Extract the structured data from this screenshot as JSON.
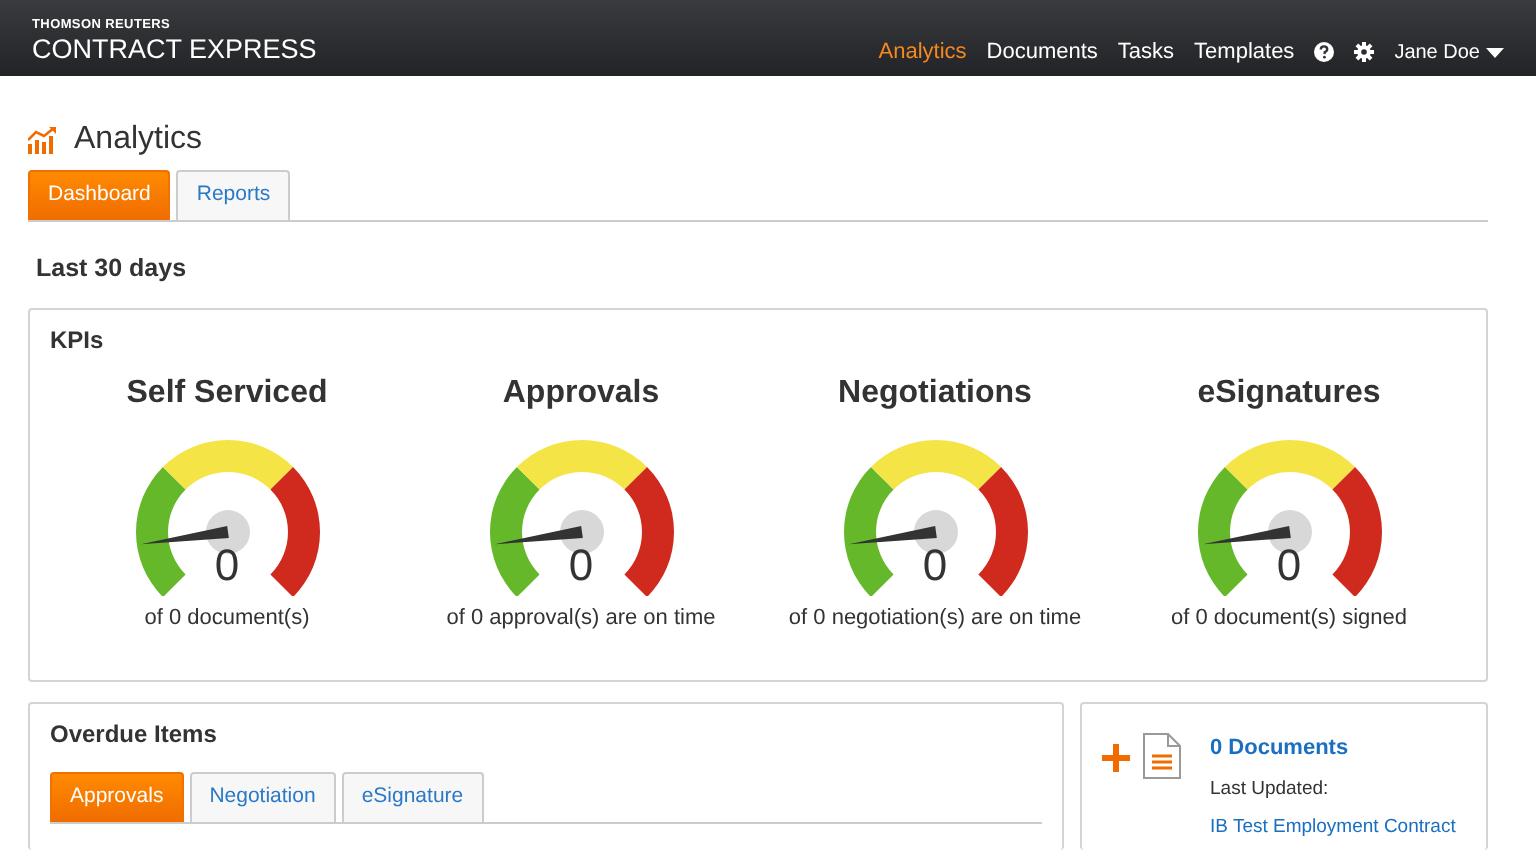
{
  "brand": {
    "top": "THOMSON REUTERS",
    "name": "CONTRACT EXPRESS"
  },
  "nav": [
    {
      "label": "Analytics",
      "selected": true
    },
    {
      "label": "Documents",
      "selected": false
    },
    {
      "label": "Tasks",
      "selected": false
    },
    {
      "label": "Templates",
      "selected": false
    }
  ],
  "user": "Jane Doe",
  "page_title": "Analytics",
  "tabs": [
    {
      "label": "Dashboard",
      "selected": true
    },
    {
      "label": "Reports",
      "selected": false
    }
  ],
  "period": "Last 30 days",
  "kpis": {
    "title": "KPIs",
    "gauges": [
      {
        "title": "Self Serviced",
        "value": "0",
        "caption": "of 0 document(s)"
      },
      {
        "title": "Approvals",
        "value": "0",
        "caption": "of 0 approval(s) are on time"
      },
      {
        "title": "Negotiations",
        "value": "0",
        "caption": "of 0 negotiation(s) are on time"
      },
      {
        "title": "eSignatures",
        "value": "0",
        "caption": "of 0 document(s) signed"
      }
    ]
  },
  "overdue": {
    "title": "Overdue Items",
    "tabs": [
      {
        "label": "Approvals",
        "selected": true
      },
      {
        "label": "Negotiation",
        "selected": false
      },
      {
        "label": "eSignature",
        "selected": false
      }
    ]
  },
  "documents": {
    "count": "0 Documents",
    "updated_label": "Last Updated:",
    "updated_link": "IB Test Employment Contract"
  }
}
